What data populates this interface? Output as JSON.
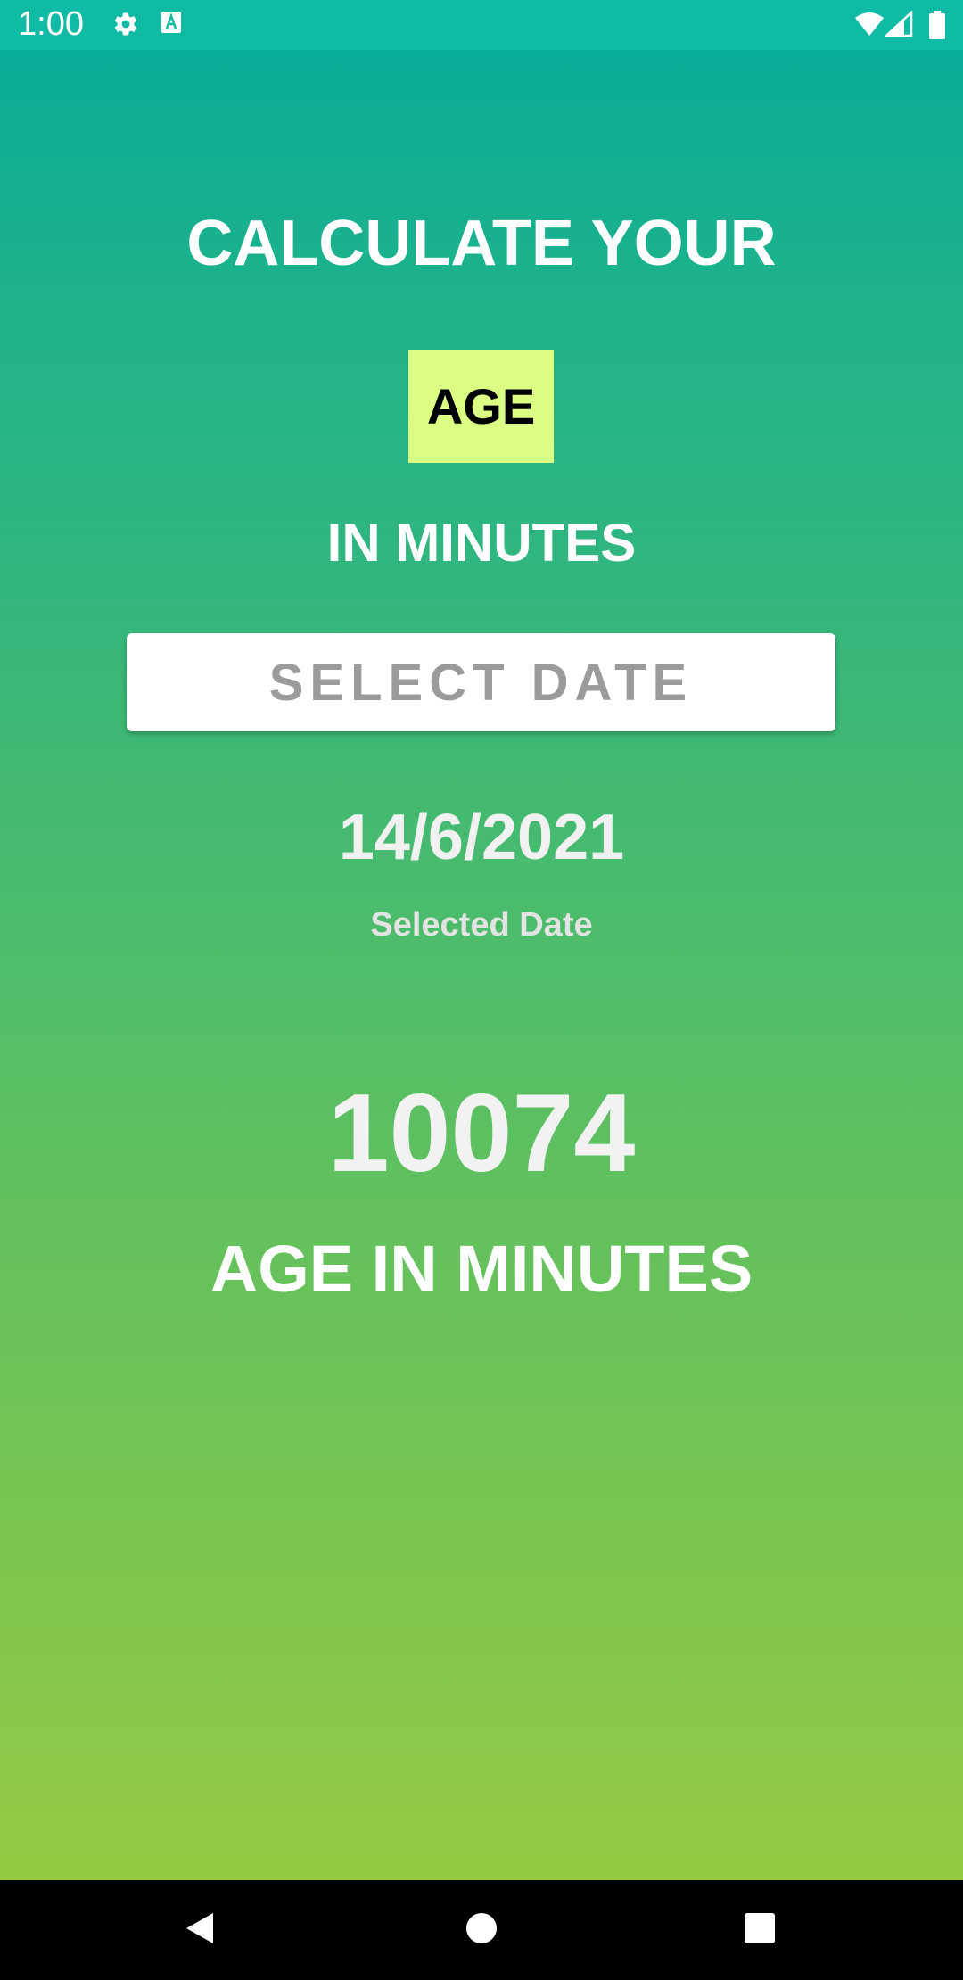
{
  "status_bar": {
    "time": "1:00",
    "icons": [
      "gear-icon",
      "a-icon",
      "wifi-icon",
      "signal-icon",
      "battery-icon"
    ]
  },
  "header": {
    "line1": "CALCULATE YOUR",
    "badge": "AGE",
    "line2": "IN MINUTES"
  },
  "select_date_button": {
    "label": "SELECT DATE"
  },
  "selected_date": {
    "value": "14/6/2021",
    "label": "Selected Date"
  },
  "age_in_minutes": {
    "value": "10074",
    "label": "AGE IN MINUTES"
  },
  "nav_bar": {
    "icons": [
      "back-icon",
      "home-icon",
      "recents-icon"
    ]
  },
  "colors": {
    "status_bar": "#10bba5",
    "gradient_top": "#07ad9a",
    "gradient_bottom": "#9ccb3d",
    "badge_background": "#dcfd84",
    "button_text": "#9b9b9b"
  }
}
